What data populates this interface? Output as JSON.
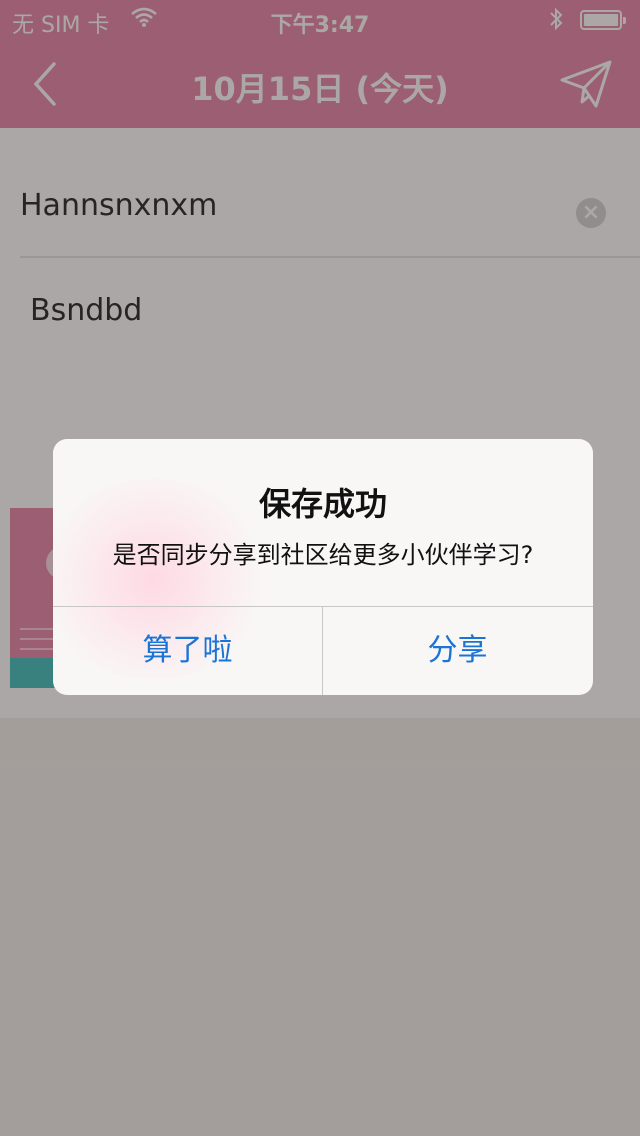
{
  "status_bar": {
    "carrier": "无 SIM 卡",
    "time": "下午3:47"
  },
  "nav": {
    "title": "10月15日 (今天)",
    "back_icon": "chevron-left-icon",
    "send_icon": "paper-plane-icon"
  },
  "editor": {
    "title_value": "Hannsnxnxm",
    "body_value": "Bsndbd"
  },
  "alert": {
    "title": "保存成功",
    "message": "是否同步分享到社区给更多小伙伴学习?",
    "cancel_label": "算了啦",
    "share_label": "分享"
  },
  "colors": {
    "brand_pink": "#e07aa0",
    "accent_blue": "#1a74d6",
    "teal": "#2dbab7"
  }
}
